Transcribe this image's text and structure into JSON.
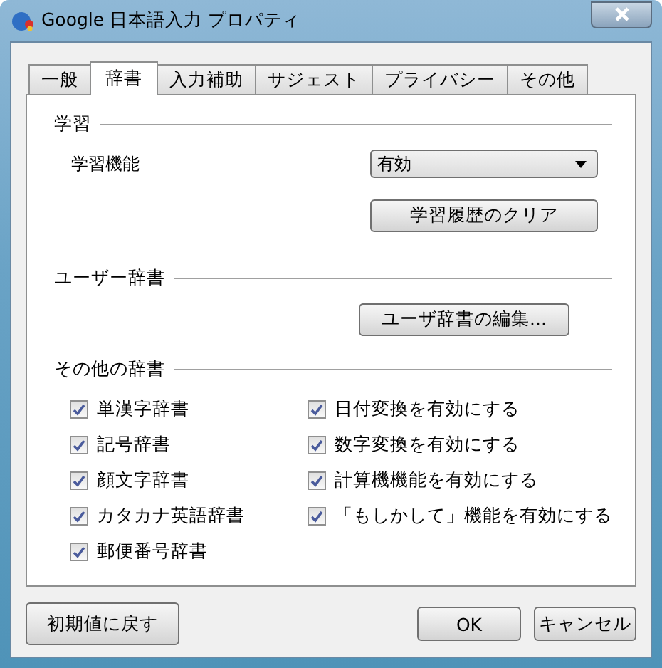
{
  "window": {
    "title": "Google 日本語入力 プロパティ"
  },
  "tabs": [
    {
      "label": "一般",
      "selected": false
    },
    {
      "label": "辞書",
      "selected": true
    },
    {
      "label": "入力補助",
      "selected": false
    },
    {
      "label": "サジェスト",
      "selected": false
    },
    {
      "label": "プライバシー",
      "selected": false
    },
    {
      "label": "その他",
      "selected": false
    }
  ],
  "learning": {
    "heading": "学習",
    "label": "学習機能",
    "dropdown_value": "有効",
    "clear_button": "学習履歴のクリア"
  },
  "user_dictionary": {
    "heading": "ユーザー辞書",
    "edit_button": "ユーザ辞書の編集..."
  },
  "other_dictionaries": {
    "heading": "その他の辞書",
    "left": [
      {
        "label": "単漢字辞書",
        "checked": true
      },
      {
        "label": "記号辞書",
        "checked": true
      },
      {
        "label": "顔文字辞書",
        "checked": true
      },
      {
        "label": "カタカナ英語辞書",
        "checked": true
      },
      {
        "label": "郵便番号辞書",
        "checked": true
      }
    ],
    "right": [
      {
        "label": "日付変換を有効にする",
        "checked": true
      },
      {
        "label": "数字変換を有効にする",
        "checked": true
      },
      {
        "label": "計算機機能を有効にする",
        "checked": true
      },
      {
        "label": "「もしかして」機能を有効にする",
        "checked": true
      }
    ]
  },
  "buttons": {
    "reset": "初期値に戻す",
    "ok": "OK",
    "cancel": "キャンセル"
  }
}
